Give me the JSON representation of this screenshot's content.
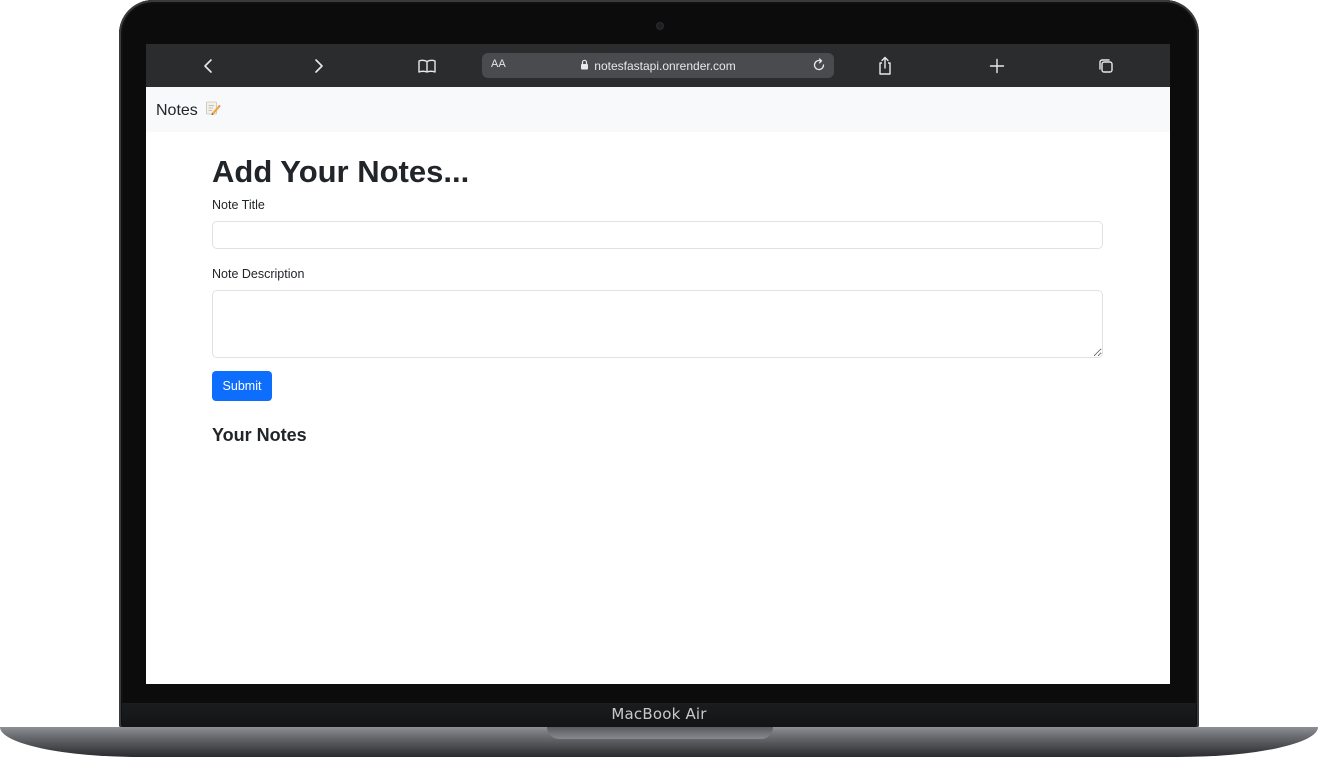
{
  "device": {
    "label": "MacBook Air"
  },
  "browser": {
    "text_size_label": "AA",
    "url": "notesfastapi.onrender.com",
    "icons": [
      "back-icon",
      "forward-icon",
      "bookmarks-icon",
      "lock-icon",
      "reload-icon",
      "share-icon",
      "new-tab-icon",
      "tabs-icon"
    ]
  },
  "navbar": {
    "brand": "Notes",
    "brand_icon": "memo-icon"
  },
  "form": {
    "heading": "Add Your Notes...",
    "title_label": "Note Title",
    "title_value": "",
    "description_label": "Note Description",
    "description_value": "",
    "submit_label": "Submit"
  },
  "notes": {
    "heading": "Your Notes",
    "items": []
  },
  "colors": {
    "toolbar": "#2b2c2e",
    "navbar": "#f8f9fa",
    "primary": "#0d6efd"
  }
}
